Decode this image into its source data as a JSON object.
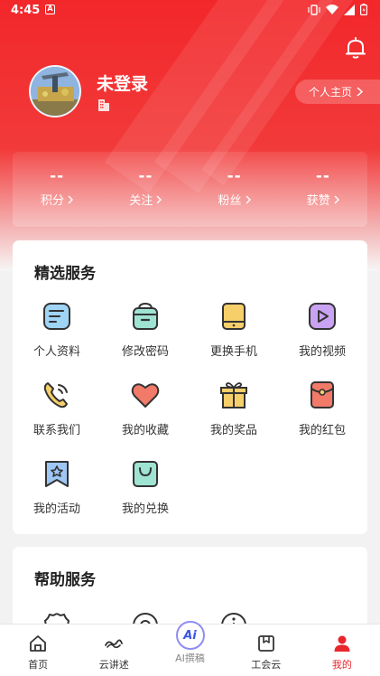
{
  "status_bar": {
    "time": "4:45",
    "notif_glyph": "A"
  },
  "profile": {
    "name": "未登录",
    "homepage_button": "个人主页"
  },
  "stats": [
    {
      "value": "--",
      "label": "积分"
    },
    {
      "value": "--",
      "label": "关注"
    },
    {
      "value": "--",
      "label": "粉丝"
    },
    {
      "value": "--",
      "label": "获赞"
    }
  ],
  "featured": {
    "title": "精选服务",
    "items": [
      {
        "label": "个人资料",
        "icon": "profile-card-icon"
      },
      {
        "label": "修改密码",
        "icon": "password-icon"
      },
      {
        "label": "更换手机",
        "icon": "phone-icon"
      },
      {
        "label": "我的视频",
        "icon": "video-icon"
      },
      {
        "label": "联系我们",
        "icon": "call-icon"
      },
      {
        "label": "我的收藏",
        "icon": "heart-icon"
      },
      {
        "label": "我的奖品",
        "icon": "gift-icon"
      },
      {
        "label": "我的红包",
        "icon": "red-packet-icon"
      },
      {
        "label": "我的活动",
        "icon": "activity-icon"
      },
      {
        "label": "我的兑换",
        "icon": "shopping-bag-icon"
      }
    ]
  },
  "help": {
    "title": "帮助服务"
  },
  "tabs": [
    {
      "label": "首页",
      "icon": "home-icon"
    },
    {
      "label": "云讲述",
      "icon": "cloud-story-icon"
    },
    {
      "label": "AI撰稿",
      "icon": "ai-icon",
      "badge": "Ai"
    },
    {
      "label": "工会云",
      "icon": "union-icon"
    },
    {
      "label": "我的",
      "icon": "user-icon",
      "active": true
    }
  ],
  "colors": {
    "brand_red": "#e8262b",
    "ai_blue": "#3b55e6"
  }
}
